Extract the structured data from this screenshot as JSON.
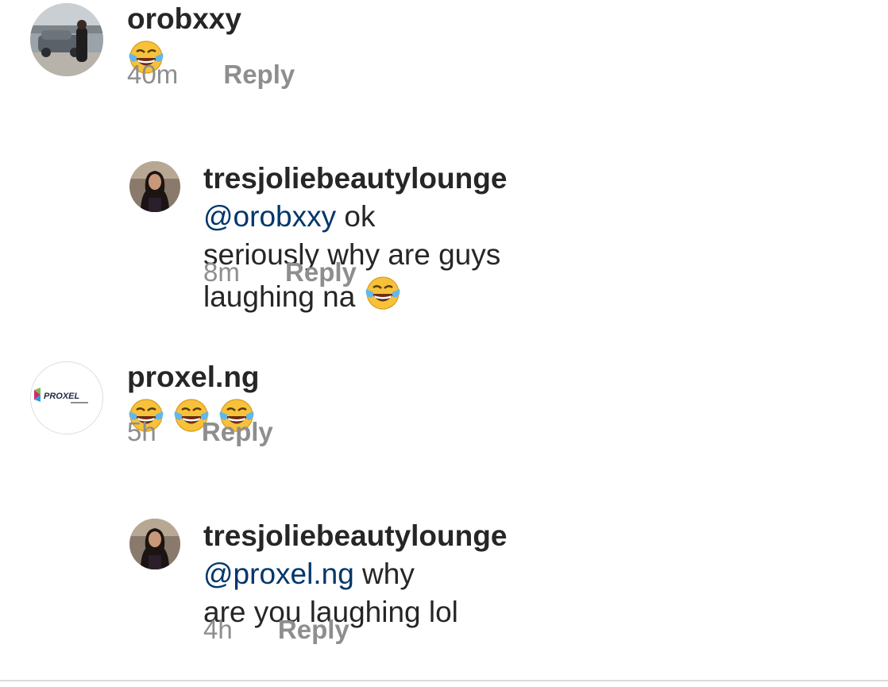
{
  "comments": [
    {
      "username": "orobxxy",
      "mention": "",
      "text": "",
      "emoji_count": 1,
      "time": "40m",
      "reply_label": "Reply"
    },
    {
      "username": "tresjoliebeautylounge",
      "mention": "@orobxxy",
      "text_line1": " ok",
      "text_line2": "seriously why are guys laughing na ",
      "emoji_count": 1,
      "time": "8m",
      "reply_label": "Reply"
    },
    {
      "username": "proxel.ng",
      "mention": "",
      "text": "",
      "emoji_count": 3,
      "avatar_logo_text": "PROXEL",
      "time": "5h",
      "reply_label": "Reply"
    },
    {
      "username": "tresjoliebeautylounge",
      "mention": "@proxel.ng",
      "text_line1": " why",
      "text_line2": "are you laughing lol",
      "time": "4h",
      "reply_label": "Reply"
    }
  ],
  "colors": {
    "text": "#262626",
    "meta": "#8e8e8e",
    "mention": "#00376b",
    "emoji_face": "#f7c23a"
  },
  "icons": [
    "face-with-tears-of-joy-emoji"
  ]
}
